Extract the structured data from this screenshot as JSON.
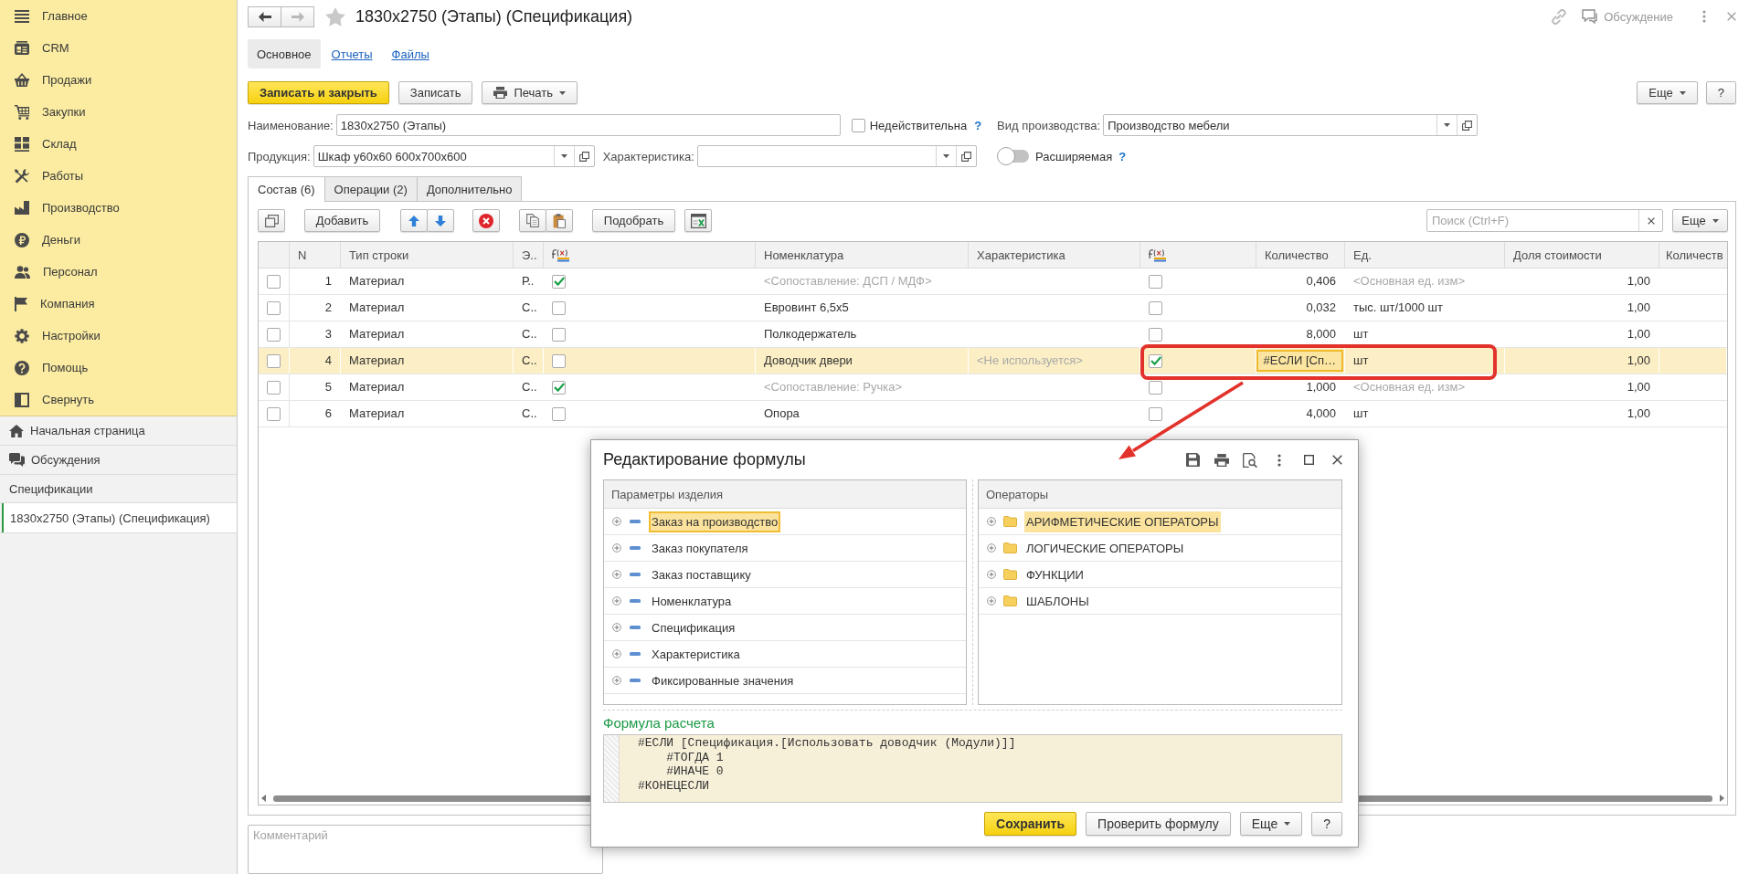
{
  "sidebar": {
    "sections": [
      "Главное",
      "CRM",
      "Продажи",
      "Закупки",
      "Склад",
      "Работы",
      "Производство",
      "Деньги",
      "Персонал",
      "Компания",
      "Настройки",
      "Помощь",
      "Свернуть"
    ],
    "links": [
      "Начальная страница",
      "Обсуждения"
    ],
    "group_title": "Спецификации",
    "open_windows": [
      {
        "label": "1830x2750 (Этапы) (Спецификация)",
        "selected": true
      }
    ]
  },
  "header": {
    "nav_buttons": [
      {
        "disabled": false
      },
      {
        "disabled": true
      }
    ],
    "favorite": false,
    "title": "1830x2750 (Этапы) (Спецификация)",
    "discussion": "Обсуждение"
  },
  "form_tabs": [
    {
      "label": "Основное",
      "selected": true
    },
    {
      "label": "Отчеты",
      "selected": false
    },
    {
      "label": "Файлы",
      "selected": false
    }
  ],
  "command_bar": {
    "buttons": [
      {
        "label": "Записать и закрыть",
        "kind": "primary"
      },
      {
        "label": "Записать",
        "kind": "plain"
      },
      {
        "label": "Печать",
        "kind": "print"
      }
    ],
    "right_buttons": [
      {
        "label": "Еще",
        "kind": "menu"
      },
      {
        "label": "?",
        "kind": "plain"
      }
    ]
  },
  "fields": {
    "name": {
      "label": "Наименование:",
      "value": "1830x2750 (Этапы)"
    },
    "invalid": {
      "label": "Недействительна",
      "checked": false,
      "help": "?"
    },
    "production_type": {
      "label": "Вид производства:",
      "value": "Производство мебели"
    },
    "product": {
      "label": "Продукция:",
      "value": "Шкаф у60x60 600x700x600"
    },
    "characteristic": {
      "label": "Характеристика:"
    },
    "extendable": {
      "label": "Расширяемая",
      "on": false,
      "help": "?"
    }
  },
  "content_tabs": [
    {
      "label": "Состав (6)",
      "selected": true
    },
    {
      "label": "Операции (2)",
      "selected": false
    },
    {
      "label": "Дополнительно",
      "selected": false
    }
  ],
  "toolbar": {
    "add": "Добавить",
    "pick": "Подобрать",
    "search": {
      "placeholder": "Поиск (Ctrl+F)"
    },
    "more": "Еще"
  },
  "table": {
    "columns": [
      {
        "label": "N",
        "kind": "number"
      },
      {
        "label": "Тип строки",
        "kind": "text"
      },
      {
        "label": "Э..",
        "kind": "text"
      },
      {
        "kind": "formula"
      },
      {
        "label": "Номенклатура",
        "kind": "text"
      },
      {
        "label": "Характеристика",
        "kind": "text"
      },
      {
        "kind": "formula"
      },
      {
        "label": "Количество",
        "kind": "number"
      },
      {
        "label": "Ед.",
        "kind": "text"
      },
      {
        "label": "Доля стоимости",
        "kind": "number"
      },
      {
        "label": "Количеств",
        "kind": "text"
      }
    ],
    "rows": [
      {
        "checked": false,
        "selected": false,
        "cells": [
          {
            "text": "1",
            "muted": false,
            "focused": false
          },
          {
            "text": "Материал",
            "muted": false,
            "focused": false
          },
          {
            "text": "Р..",
            "muted": false,
            "focused": false
          },
          {
            "checked": true
          },
          {
            "text": "<Сопоставление: ДСП / МДФ>",
            "muted": true,
            "focused": false
          },
          null,
          {
            "checked": false
          },
          {
            "text": "0,406",
            "muted": false,
            "focused": false
          },
          {
            "text": "<Основная ед. изм>",
            "muted": true,
            "focused": false
          },
          {
            "text": "1,00",
            "muted": false,
            "focused": false
          },
          null
        ]
      },
      {
        "checked": false,
        "selected": false,
        "cells": [
          {
            "text": "2",
            "muted": false,
            "focused": false
          },
          {
            "text": "Материал",
            "muted": false,
            "focused": false
          },
          {
            "text": "С..",
            "muted": false,
            "focused": false
          },
          {
            "checked": false
          },
          {
            "text": "Евровинт 6,5x5",
            "muted": false,
            "focused": false
          },
          null,
          {
            "checked": false
          },
          {
            "text": "0,032",
            "muted": false,
            "focused": false
          },
          {
            "text": "тыс. шт/1000 шт",
            "muted": false,
            "focused": false
          },
          {
            "text": "1,00",
            "muted": false,
            "focused": false
          },
          null
        ]
      },
      {
        "checked": false,
        "selected": false,
        "cells": [
          {
            "text": "3",
            "muted": false,
            "focused": false
          },
          {
            "text": "Материал",
            "muted": false,
            "focused": false
          },
          {
            "text": "С..",
            "muted": false,
            "focused": false
          },
          {
            "checked": false
          },
          {
            "text": "Полкодержатель",
            "muted": false,
            "focused": false
          },
          null,
          {
            "checked": false
          },
          {
            "text": "8,000",
            "muted": false,
            "focused": false
          },
          {
            "text": "шт",
            "muted": false,
            "focused": false
          },
          {
            "text": "1,00",
            "muted": false,
            "focused": false
          },
          null
        ]
      },
      {
        "checked": false,
        "selected": true,
        "cells": [
          {
            "text": "4",
            "muted": false,
            "focused": false
          },
          {
            "text": "Материал",
            "muted": false,
            "focused": false
          },
          {
            "text": "С..",
            "muted": false,
            "focused": false
          },
          {
            "checked": false
          },
          {
            "text": "Доводчик двери",
            "muted": false,
            "focused": false
          },
          {
            "text": "<Не используется>",
            "muted": true,
            "focused": false
          },
          {
            "checked": true
          },
          {
            "text": "#ЕСЛИ [Сп…",
            "muted": false,
            "focused": true
          },
          {
            "text": "шт",
            "muted": false,
            "focused": false
          },
          {
            "text": "1,00",
            "muted": false,
            "focused": false
          },
          null
        ]
      },
      {
        "checked": false,
        "selected": false,
        "cells": [
          {
            "text": "5",
            "muted": false,
            "focused": false
          },
          {
            "text": "Материал",
            "muted": false,
            "focused": false
          },
          {
            "text": "С..",
            "muted": false,
            "focused": false
          },
          {
            "checked": true
          },
          {
            "text": "<Сопоставление: Ручка>",
            "muted": true,
            "focused": false
          },
          null,
          {
            "checked": false
          },
          {
            "text": "1,000",
            "muted": false,
            "focused": false
          },
          {
            "text": "<Основная ед. изм>",
            "muted": true,
            "focused": false
          },
          {
            "text": "1,00",
            "muted": false,
            "focused": false
          },
          null
        ]
      },
      {
        "checked": false,
        "selected": false,
        "cells": [
          {
            "text": "6",
            "muted": false,
            "focused": false
          },
          {
            "text": "Материал",
            "muted": false,
            "focused": false
          },
          {
            "text": "С..",
            "muted": false,
            "focused": false
          },
          {
            "checked": false
          },
          {
            "text": "Опора",
            "muted": false,
            "focused": false
          },
          null,
          {
            "checked": false
          },
          {
            "text": "4,000",
            "muted": false,
            "focused": false
          },
          {
            "text": "шт",
            "muted": false,
            "focused": false
          },
          {
            "text": "1,00",
            "muted": false,
            "focused": false
          },
          null
        ]
      }
    ]
  },
  "comment": {
    "placeholder": "Комментарий"
  },
  "formula_dialog": {
    "title": "Редактирование формулы",
    "parameters": {
      "title": "Параметры изделия",
      "focused": true,
      "items": [
        {
          "label": "Заказ на производство",
          "selected": true,
          "expanded": false
        },
        {
          "label": "Заказ покупателя",
          "selected": false,
          "expanded": false
        },
        {
          "label": "Заказ поставщику",
          "selected": false,
          "expanded": false
        },
        {
          "label": "Номенклатура",
          "selected": false,
          "expanded": false
        },
        {
          "label": "Спецификация",
          "selected": false,
          "expanded": false
        },
        {
          "label": "Характеристика",
          "selected": false,
          "expanded": false
        },
        {
          "label": "Фиксированные значения",
          "selected": false,
          "expanded": false
        }
      ]
    },
    "operators": {
      "title": "Операторы",
      "focused": false,
      "items": [
        {
          "label": "АРИФМЕТИЧЕСКИЕ ОПЕРАТОРЫ",
          "selected": true,
          "expanded": false
        },
        {
          "label": "ЛОГИЧЕСКИЕ ОПЕРАТОРЫ",
          "selected": false,
          "expanded": false
        },
        {
          "label": "ФУНКЦИИ",
          "selected": false,
          "expanded": false
        },
        {
          "label": "ШАБЛОНЫ",
          "selected": false,
          "expanded": false
        }
      ]
    },
    "formula": {
      "label": "Формула расчета",
      "lines": [
        "#ЕСЛИ [Спецификация.[Использовать доводчик (Модули)]]",
        "    #ТОГДА 1",
        "    #ИНАЧЕ 0",
        "#КОНЕЦЕСЛИ"
      ]
    },
    "buttons": [
      {
        "label": "Сохранить",
        "kind": "primary"
      },
      {
        "label": "Проверить формулу",
        "kind": "plain"
      },
      {
        "label": "Еще",
        "kind": "menu"
      },
      {
        "label": "?",
        "kind": "plain"
      }
    ]
  }
}
